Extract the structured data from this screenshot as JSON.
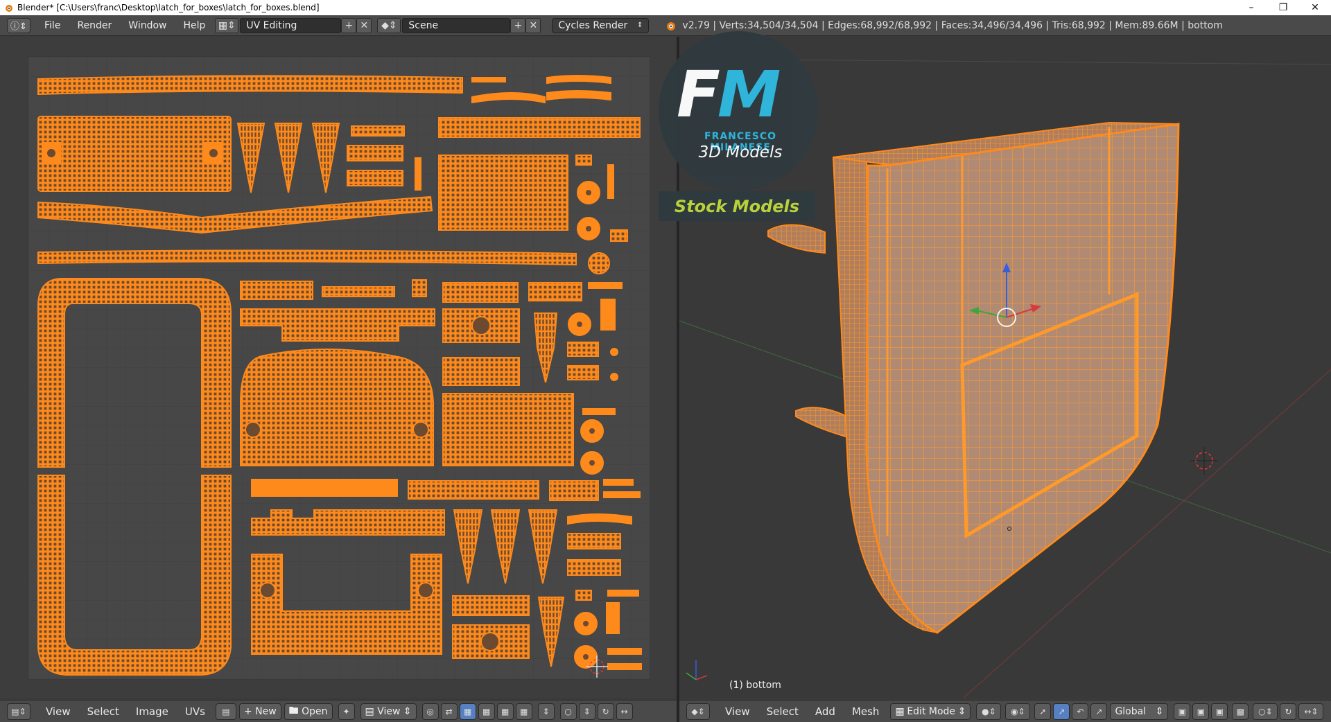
{
  "window": {
    "title": "Blender* [C:\\Users\\franc\\Desktop\\latch_for_boxes\\latch_for_boxes.blend]",
    "min_icon": "minimize-icon",
    "max_icon": "restore-icon",
    "close_icon": "close-icon"
  },
  "info_header": {
    "menus": [
      "File",
      "Render",
      "Window",
      "Help"
    ],
    "screen_layout": "UV Editing",
    "scene": "Scene",
    "render_engine": "Cycles Render",
    "stats": "v2.79 | Verts:34,504/34,504 | Edges:68,992/68,992 | Faces:34,496/34,496 | Tris:68,992 | Mem:89.66M | bottom"
  },
  "uv_editor": {
    "menus": [
      "View",
      "Select",
      "Image",
      "UVs"
    ],
    "new_label": "New",
    "open_label": "Open",
    "view_label": "View"
  },
  "viewport": {
    "object_label": "(1) bottom",
    "menus": [
      "View",
      "Select",
      "Add",
      "Mesh"
    ],
    "mode": "Edit Mode",
    "orientation": "Global"
  },
  "watermark": {
    "letters_f": "F",
    "letters_m": "M",
    "brand": "FRANCESCO MILANESE",
    "subtitle": "3D Models",
    "banner": "Stock Models"
  },
  "colors": {
    "uv_orange": "#ff8a1c",
    "mesh_fill": "#b08a73",
    "accent_blue": "#2fb8e0",
    "banner_green": "#b9d23a"
  }
}
